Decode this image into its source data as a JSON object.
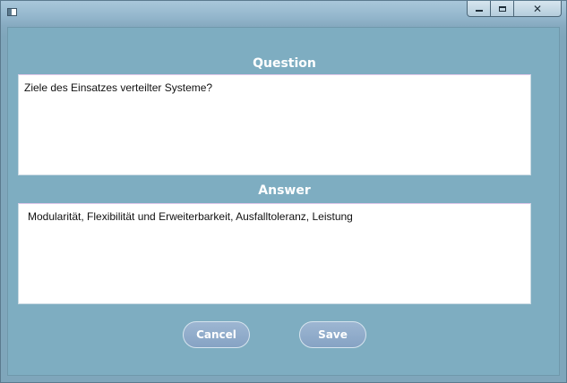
{
  "window": {
    "title": "",
    "close_glyph": "✕"
  },
  "form": {
    "question_label": "Question",
    "question_value": "Ziele des Einsatzes verteilter Systeme?",
    "answer_label": "Answer",
    "answer_value": "Modularität, Flexibilität und Erweiterbarkeit, Ausfalltoleranz, Leistung"
  },
  "buttons": {
    "cancel_label": "Cancel",
    "save_label": "Save"
  },
  "icons": {
    "app": "app-window-icon",
    "minimize": "minimize-icon",
    "maximize": "maximize-icon",
    "close": "close-icon"
  },
  "colors": {
    "client_background": "#7eadc1",
    "button_fill": "#8fabca",
    "label_text": "#ffffff"
  }
}
